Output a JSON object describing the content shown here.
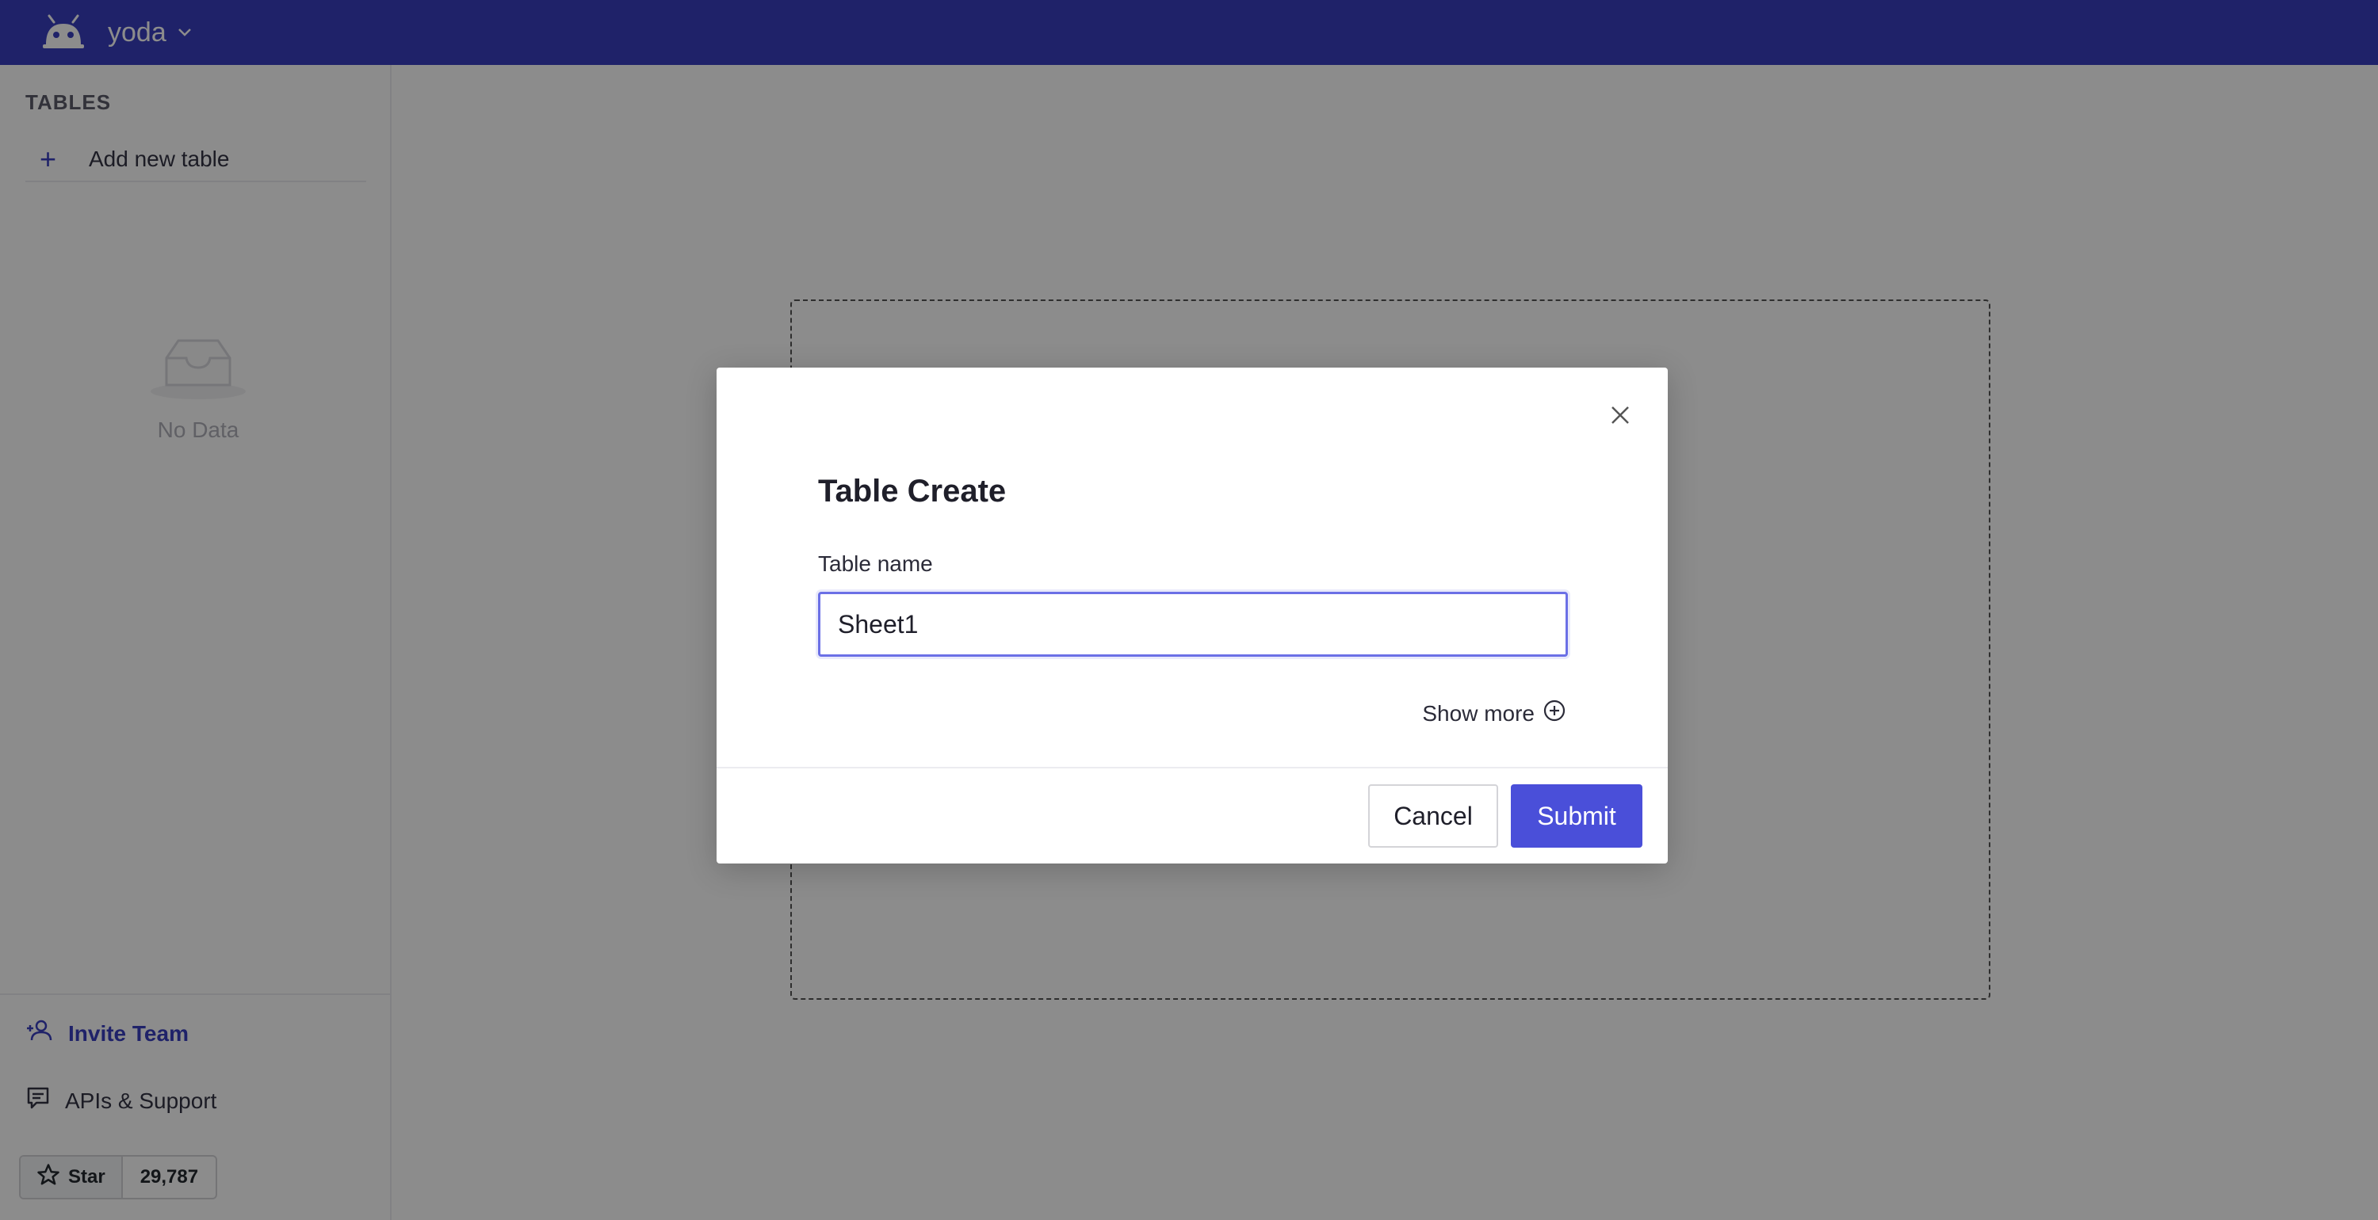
{
  "topbar": {
    "workspace_name": "yoda"
  },
  "sidebar": {
    "heading": "TABLES",
    "add_table_label": "Add new table",
    "empty_text": "No Data",
    "invite_label": "Invite Team",
    "apis_label": "APIs & Support",
    "star_label": "Star",
    "star_count": "29,787"
  },
  "modal": {
    "title": "Table Create",
    "field_label": "Table name",
    "field_value": "Sheet1",
    "show_more_label": "Show more",
    "cancel_label": "Cancel",
    "submit_label": "Submit"
  },
  "colors": {
    "brand": "#3a3fbf",
    "primary_button": "#4a4fd9",
    "input_focus_border": "#6b70e6"
  },
  "icons": {
    "logo": "robot-logo-icon",
    "workspace_chevron": "chevron-down-icon",
    "add": "plus-icon",
    "empty": "inbox-icon",
    "invite": "user-plus-icon",
    "apis": "chat-icon",
    "star": "star-icon",
    "close": "close-icon",
    "show_more": "plus-circle-icon"
  }
}
